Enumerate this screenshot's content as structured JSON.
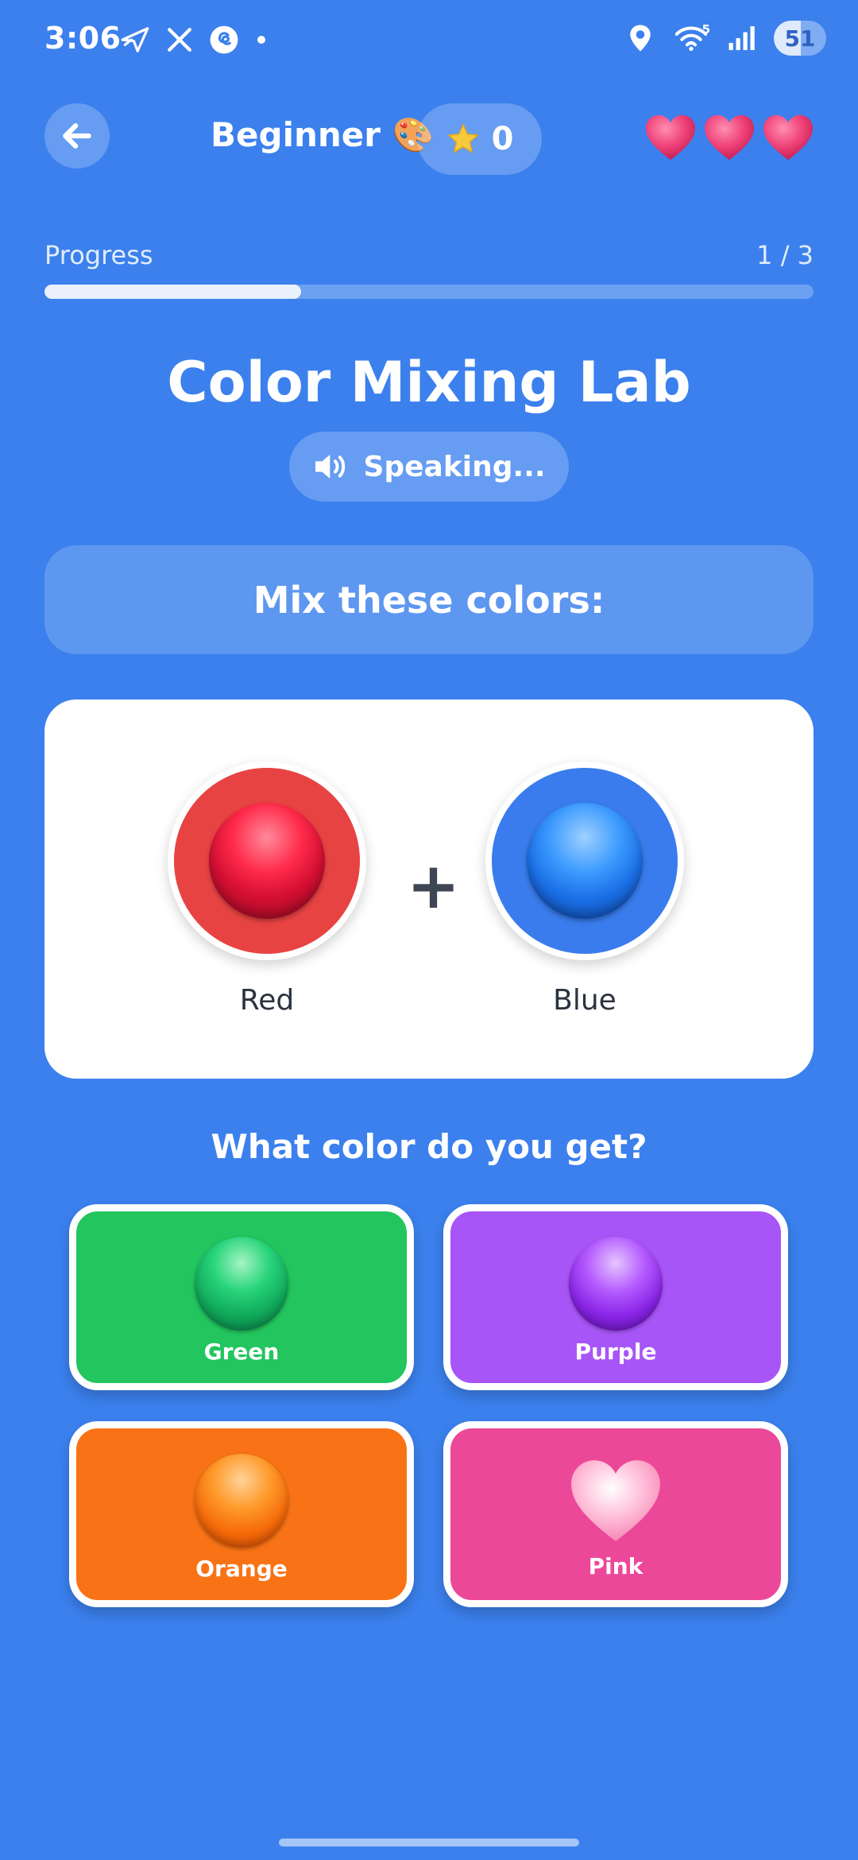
{
  "status_bar": {
    "time": "3:06",
    "left_icons": [
      "messenger-icon",
      "x-icon",
      "threads-icon",
      "dot-icon"
    ],
    "right_icons": [
      "location-icon",
      "wifi-icon",
      "signal-icon"
    ],
    "wifi_badge": "5",
    "battery": "51",
    "battery_level": 0.51
  },
  "header": {
    "back_icon": "arrow-left-icon",
    "level": "Beginner 🎨",
    "score": "0",
    "score_icon": "star-icon",
    "lives": 3
  },
  "progress": {
    "label": "Progress",
    "count": "1 / 3",
    "fraction": 0.3333
  },
  "game": {
    "title": "Color Mixing Lab",
    "speaking": "Speaking...",
    "speaker_icon": "speaker-icon",
    "instruction": "Mix these colors:",
    "colors": [
      {
        "label": "Red",
        "color": "#e84343"
      },
      {
        "label": "Blue",
        "color": "#3a7ced"
      }
    ],
    "operator": "+",
    "question": "What color do you get?"
  },
  "options": [
    {
      "label": "Green",
      "color": "#22c55e"
    },
    {
      "label": "Purple",
      "color": "#a855f7"
    },
    {
      "label": "Orange",
      "color": "#f97316"
    },
    {
      "label": "Pink",
      "color": "#ec4899"
    }
  ],
  "theme": {
    "background": "#3b80ed",
    "heart_color": "#f0447a"
  }
}
